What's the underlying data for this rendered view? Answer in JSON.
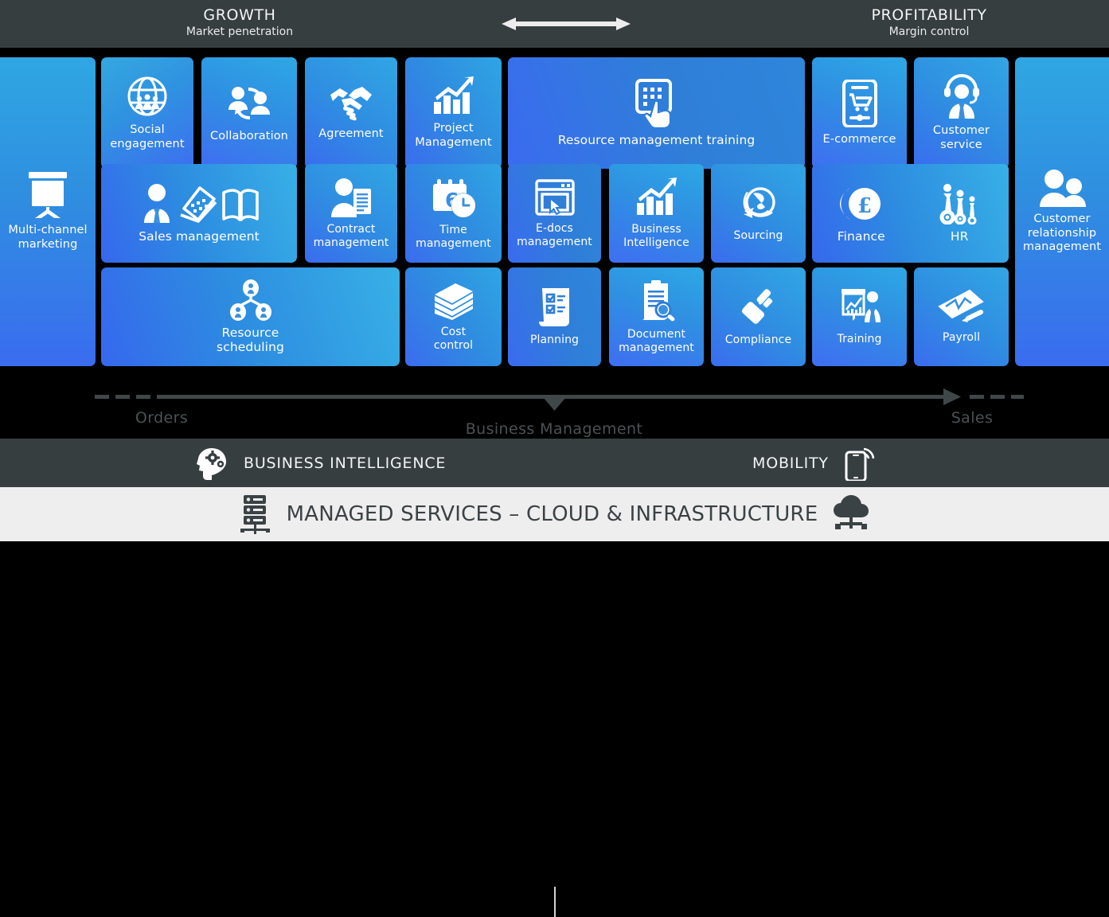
{
  "header": {
    "growth": {
      "title": "GROWTH",
      "subtitle": "Market penetration"
    },
    "profitability": {
      "title": "PROFITABILITY",
      "subtitle": "Margin control"
    },
    "arrow_icon": "double-headed-arrow-icon"
  },
  "colors": {
    "band_dark": "#363e40",
    "band_light": "#eeeeee",
    "background": "#000000",
    "tile_cyan": "#31a6e4",
    "tile_blue": "#3a6cef",
    "flow_gray": "#4a5255"
  },
  "tiles": {
    "multi_channel": {
      "label": "Multi-channel\nmarketing",
      "icon": "presentation-screen-icon"
    },
    "social": {
      "label": "Social\nengagement",
      "icon": "globe-people-icon"
    },
    "collaboration": {
      "label": "Collaboration",
      "icon": "two-people-cycle-icon"
    },
    "agreement": {
      "label": "Agreement",
      "icon": "handshake-icon"
    },
    "project_management": {
      "label": "Project\nManagement",
      "icon": "bar-chart-arrow-icon"
    },
    "resource_training": {
      "label": "Resource management training",
      "icon": "tablet-touch-icon"
    },
    "ecommerce": {
      "label": "E-commerce",
      "icon": "phone-cart-icon"
    },
    "customer_service": {
      "label": "Customer\nservice",
      "icon": "headset-agent-icon"
    },
    "crm": {
      "label": "Customer\nrelationship\nmanagement",
      "icon": "two-users-icon"
    },
    "sales_management": {
      "label": "Sales management",
      "icon": "person-laptop-book-icon"
    },
    "contract_management": {
      "label": "Contract\nmanagement",
      "icon": "person-document-icon"
    },
    "time_management": {
      "label": "Time\nmanagement",
      "icon": "calendar-clock-icon"
    },
    "edocs_management": {
      "label": "E-docs\nmanagement",
      "icon": "browser-cursor-icon"
    },
    "business_intelligence": {
      "label": "Business\nIntelligence",
      "icon": "bar-chart-arrow-icon"
    },
    "sourcing": {
      "label": "Sourcing",
      "icon": "globe-recycle-icon"
    },
    "finance": {
      "label": "Finance",
      "icon": "pound-coin-icon"
    },
    "hr": {
      "label": "HR",
      "icon": "people-gears-icon"
    },
    "resource_scheduling": {
      "label": "Resource\nscheduling",
      "icon": "org-chart-people-icon"
    },
    "cost_control": {
      "label": "Cost\ncontrol",
      "icon": "money-stack-icon"
    },
    "planning": {
      "label": "Planning",
      "icon": "checklist-icon"
    },
    "document_management": {
      "label": "Document\nmanagement",
      "icon": "clipboard-search-icon"
    },
    "compliance": {
      "label": "Compliance",
      "icon": "gavel-icon"
    },
    "training": {
      "label": "Training",
      "icon": "whiteboard-presenter-icon"
    },
    "payroll": {
      "label": "Payroll",
      "icon": "cheque-pen-icon"
    }
  },
  "flow": {
    "left_label": "Orders",
    "center_label": "Business Management",
    "right_label": "Sales",
    "arrow_icon": "long-right-arrow-icon",
    "marker_icon": "down-triangle-marker-icon"
  },
  "services": {
    "business_intelligence": {
      "label": "BUSINESS INTELLIGENCE",
      "icon": "head-gears-icon"
    },
    "mobility": {
      "label": "MOBILITY",
      "icon": "mobile-signal-icon"
    }
  },
  "managed": {
    "label": "MANAGED SERVICES – CLOUD & INFRASTRUCTURE",
    "left_icon": "server-rack-icon",
    "right_icon": "cloud-network-icon"
  }
}
